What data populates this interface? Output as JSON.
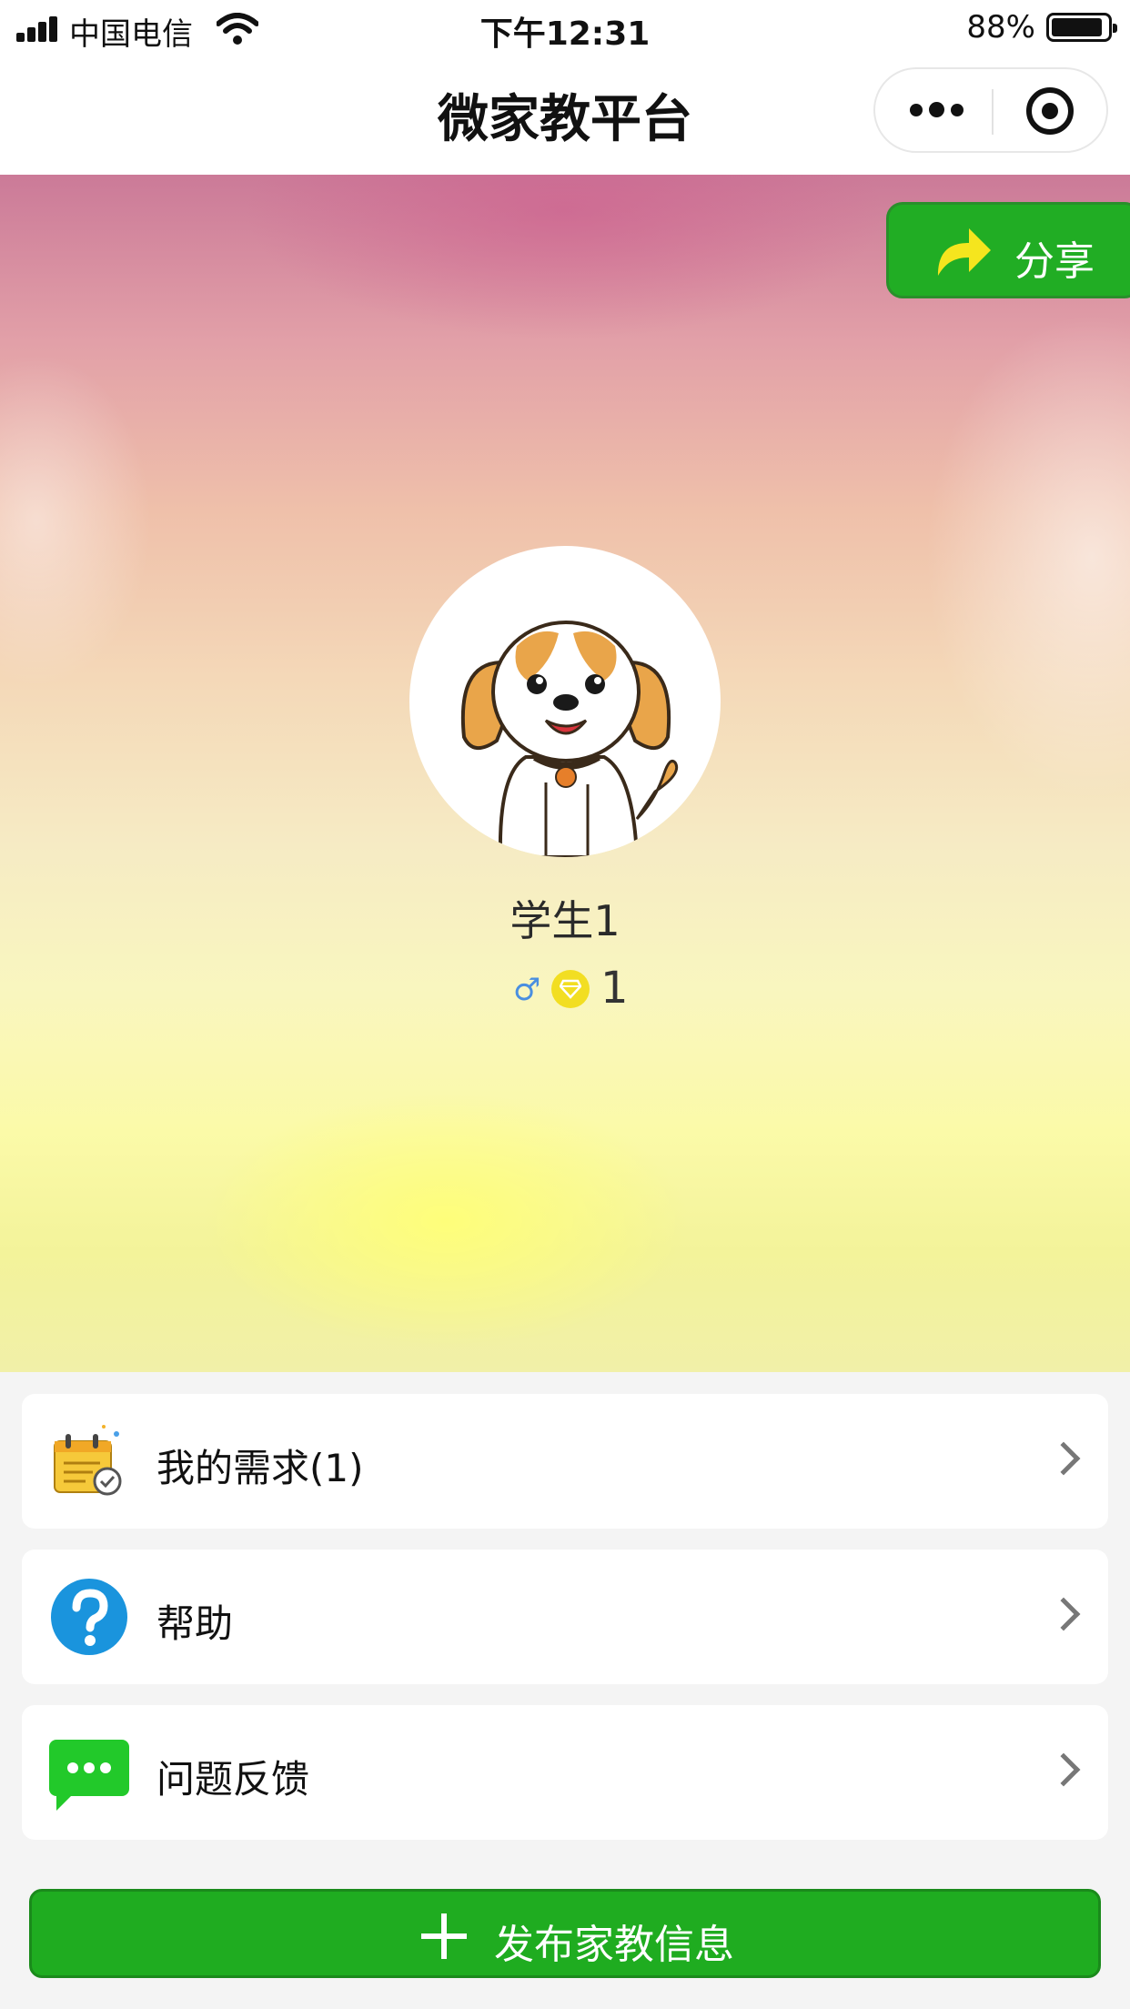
{
  "status_bar": {
    "carrier": "中国电信",
    "time": "下午12:31",
    "battery_percent": "88%",
    "battery_level": 0.88
  },
  "navbar": {
    "title": "微家教平台"
  },
  "hero": {
    "share_label": "分享",
    "username": "学生1",
    "gender_symbol": "♂",
    "level": "1"
  },
  "menu": {
    "items": [
      {
        "label": "我的需求(1)",
        "icon": "calendar-check-icon"
      },
      {
        "label": "帮助",
        "icon": "help-icon"
      },
      {
        "label": "问题反馈",
        "icon": "chat-bubble-icon"
      }
    ]
  },
  "publish": {
    "label": "发布家教信息"
  },
  "colors": {
    "brand_green": "#1fac20",
    "help_blue": "#1a94dd",
    "chat_green": "#22c92a"
  }
}
